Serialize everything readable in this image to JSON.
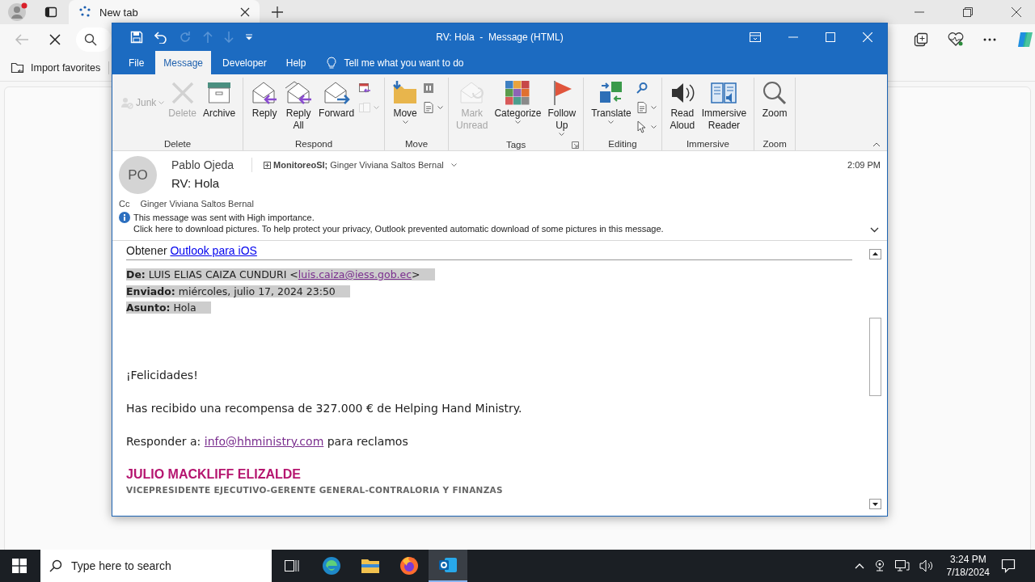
{
  "browser": {
    "tabs": [
      {
        "label": "New tab",
        "selected": true
      }
    ],
    "favorites_bar": [
      {
        "label": "Import favorites"
      }
    ]
  },
  "outlook": {
    "title": "RV: Hola  -  Message (HTML)",
    "menu_tabs": [
      {
        "label": "File",
        "selected": false
      },
      {
        "label": "Message",
        "selected": true
      },
      {
        "label": "Developer",
        "selected": false
      },
      {
        "label": "Help",
        "selected": false
      }
    ],
    "tell_me": "Tell me what you want to do",
    "ribbon_groups": [
      {
        "label": "Delete",
        "launcher": false,
        "buttons": [
          {
            "kind": "small",
            "label": "Junk",
            "disabled": true,
            "dropdown": true
          },
          {
            "kind": "large",
            "label": "Delete",
            "disabled": true,
            "dropdown": false
          },
          {
            "kind": "large",
            "label": "Archive",
            "disabled": false,
            "dropdown": false
          }
        ]
      },
      {
        "label": "Respond",
        "launcher": false,
        "buttons": [
          {
            "kind": "large",
            "label": "Reply",
            "disabled": false,
            "dropdown": false
          },
          {
            "kind": "large",
            "label": "Reply All",
            "disabled": false,
            "dropdown": false
          },
          {
            "kind": "large",
            "label": "Forward",
            "disabled": false,
            "dropdown": false
          },
          {
            "kind": "icon",
            "disabled": false,
            "dropdown": false
          },
          {
            "kind": "icon",
            "disabled": true,
            "dropdown": true
          }
        ]
      },
      {
        "label": "Move",
        "launcher": false,
        "buttons": [
          {
            "kind": "large",
            "label": "Move",
            "disabled": false,
            "dropdown": true
          },
          {
            "kind": "icon",
            "disabled": false,
            "dropdown": false
          },
          {
            "kind": "icon",
            "disabled": false,
            "dropdown": true
          }
        ]
      },
      {
        "label": "Tags",
        "launcher": true,
        "buttons": [
          {
            "kind": "large",
            "label": "Mark Unread",
            "disabled": true,
            "dropdown": false
          },
          {
            "kind": "large",
            "label": "Categorize",
            "disabled": false,
            "dropdown": true
          },
          {
            "kind": "large",
            "label": "Follow Up",
            "disabled": false,
            "dropdown": true
          }
        ]
      },
      {
        "label": "Editing",
        "launcher": false,
        "buttons": [
          {
            "kind": "large",
            "label": "Translate",
            "disabled": false,
            "dropdown": true
          },
          {
            "kind": "icon",
            "disabled": false,
            "dropdown": false
          },
          {
            "kind": "icon",
            "disabled": false,
            "dropdown": true
          },
          {
            "kind": "icon",
            "disabled": false,
            "dropdown": true
          }
        ]
      },
      {
        "label": "Immersive",
        "launcher": false,
        "buttons": [
          {
            "kind": "large",
            "label": "Read Aloud",
            "disabled": false,
            "dropdown": false
          },
          {
            "kind": "large",
            "label": "Immersive Reader",
            "disabled": false,
            "dropdown": false
          }
        ]
      },
      {
        "label": "Zoom",
        "launcher": false,
        "buttons": [
          {
            "kind": "large",
            "label": "Zoom",
            "disabled": false,
            "dropdown": false
          }
        ]
      }
    ],
    "message": {
      "avatar_initials": "PO",
      "sender": "Pablo Ojeda",
      "to": [
        {
          "name": "MonitoreoSI;",
          "kind": "group"
        },
        {
          "name": "Ginger Viviana Saltos Bernal",
          "kind": "person"
        }
      ],
      "time": "2:09 PM",
      "subject": "RV: Hola",
      "cc_label": "Cc",
      "cc": "Ginger Viviana Saltos Bernal",
      "infobar": [
        "This message was sent with High importance.",
        "Click here to download pictures. To help protect your privacy, Outlook prevented automatic download of some pictures in this message."
      ]
    },
    "body": {
      "top_line": {
        "text": "Obtener ",
        "link": "Outlook para iOS"
      },
      "header_fields": [
        {
          "text": "**De:** LUIS ELIAS CAIZA CUNDURI <",
          "link": "luis.caiza@iess.gob.ec",
          "after": ">"
        },
        {
          "text": "**Enviado:** miércoles, julio 17, 2024 23:50"
        },
        {
          "text": "**Asunto:** Hola"
        }
      ],
      "paragraphs": [
        {
          "text": "¡Felicidades!"
        },
        {
          "text": "Has recibido una recompensa de 327.000 € de Helping Hand Ministry."
        },
        {
          "text": "Responder a: ",
          "link": "info@hhministry.com",
          "after": " para reclamos"
        }
      ],
      "signature": {
        "name": "JULIO MACKLIFF ELIZALDE",
        "title": "VICEPRESIDENTE EJECUTIVO-GERENTE GENERAL-CONTRALORIA Y FINANZAS"
      }
    }
  },
  "taskbar": {
    "search_placeholder": "Type here to search",
    "apps": [
      {
        "selected": false
      },
      {
        "selected": false
      },
      {
        "selected": false
      },
      {
        "selected": true
      }
    ],
    "time": "3:24 PM",
    "date": "7/18/2024"
  }
}
